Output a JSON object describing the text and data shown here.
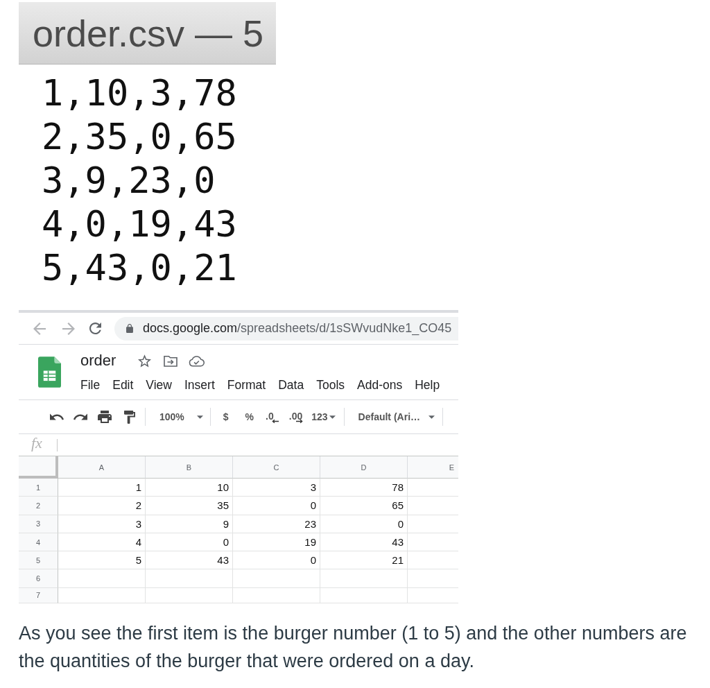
{
  "text_editor": {
    "title": "order.csv — 5",
    "lines": [
      "1,10,3,78",
      "2,35,0,65",
      "3,9,23,0",
      "4,0,19,43",
      "5,43,0,21"
    ]
  },
  "browser": {
    "url_host": "docs.google.com",
    "url_path": "/spreadsheets/d/1sSWvudNke1_CO45"
  },
  "spreadsheet": {
    "title": "order",
    "menu": [
      "File",
      "Edit",
      "View",
      "Insert",
      "Format",
      "Data",
      "Tools",
      "Add-ons",
      "Help"
    ],
    "toolbar": {
      "zoom": "100%",
      "currency": "$",
      "percent": "%",
      "decrease_decimal": ".0",
      "increase_decimal": ".00",
      "number_format": "123",
      "font": "Default (Ari…"
    },
    "formula_bar": {
      "label": "fx"
    },
    "columns": [
      "A",
      "B",
      "C",
      "D",
      "E"
    ],
    "rows": [
      {
        "number": "1",
        "cells": [
          "1",
          "10",
          "3",
          "78"
        ]
      },
      {
        "number": "2",
        "cells": [
          "2",
          "35",
          "0",
          "65"
        ]
      },
      {
        "number": "3",
        "cells": [
          "3",
          "9",
          "23",
          "0"
        ]
      },
      {
        "number": "4",
        "cells": [
          "4",
          "0",
          "19",
          "43"
        ]
      },
      {
        "number": "5",
        "cells": [
          "5",
          "43",
          "0",
          "21"
        ]
      },
      {
        "number": "6"
      },
      {
        "number": "7"
      }
    ]
  },
  "caption": "As you see the first item is the burger number (1 to 5) and the other numbers are the quantities of the burger that were ordered on a day."
}
